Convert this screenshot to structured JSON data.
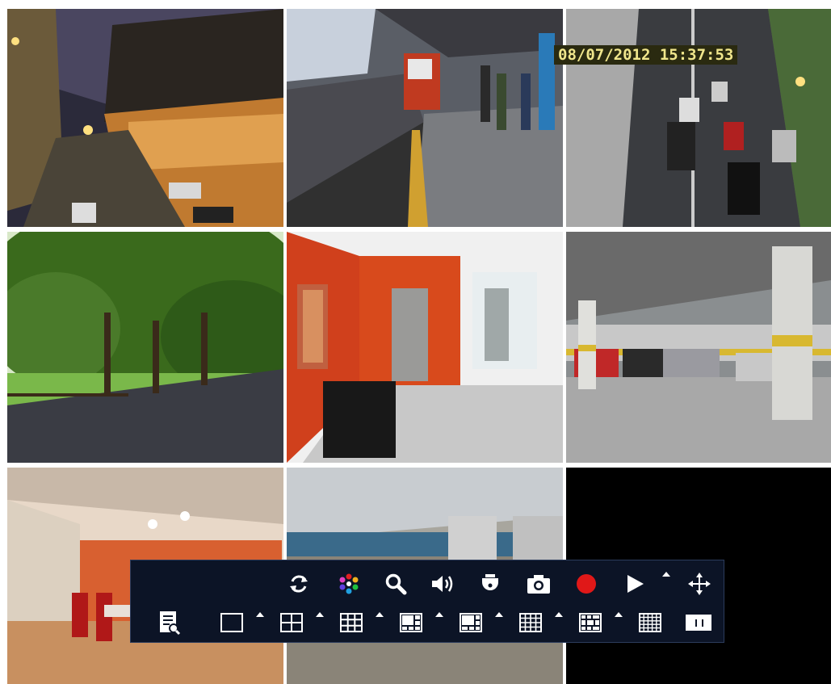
{
  "overlay": {
    "timestamp": "08/07/2012 15:37:53"
  },
  "cameras": [
    {
      "id": 1,
      "scene": "night street"
    },
    {
      "id": 2,
      "scene": "train platform"
    },
    {
      "id": 3,
      "scene": "highway traffic"
    },
    {
      "id": 4,
      "scene": "tree lined park"
    },
    {
      "id": 5,
      "scene": "lobby with red walls"
    },
    {
      "id": 6,
      "scene": "parking garage"
    },
    {
      "id": 7,
      "scene": "glass meeting room"
    },
    {
      "id": 8,
      "scene": "office floor"
    },
    {
      "id": 9,
      "scene": "no signal"
    }
  ],
  "toolbar": {
    "top_row": [
      "refresh-icon",
      "color-icon",
      "zoom-icon",
      "audio-icon",
      "ptz-icon",
      "snapshot-icon",
      "record-icon",
      "playback-icon",
      "move-icon"
    ],
    "bottom_row": [
      "search-log-icon",
      "layout-1-icon",
      "layout-4-icon",
      "layout-9-icon",
      "layout-8-icon",
      "layout-6-icon",
      "layout-16-icon",
      "layout-13-icon",
      "layout-25-icon",
      "sequence-icon"
    ],
    "colors": {
      "background": "#0c1426",
      "icon": "#ffffff",
      "record": "#e01818"
    }
  }
}
